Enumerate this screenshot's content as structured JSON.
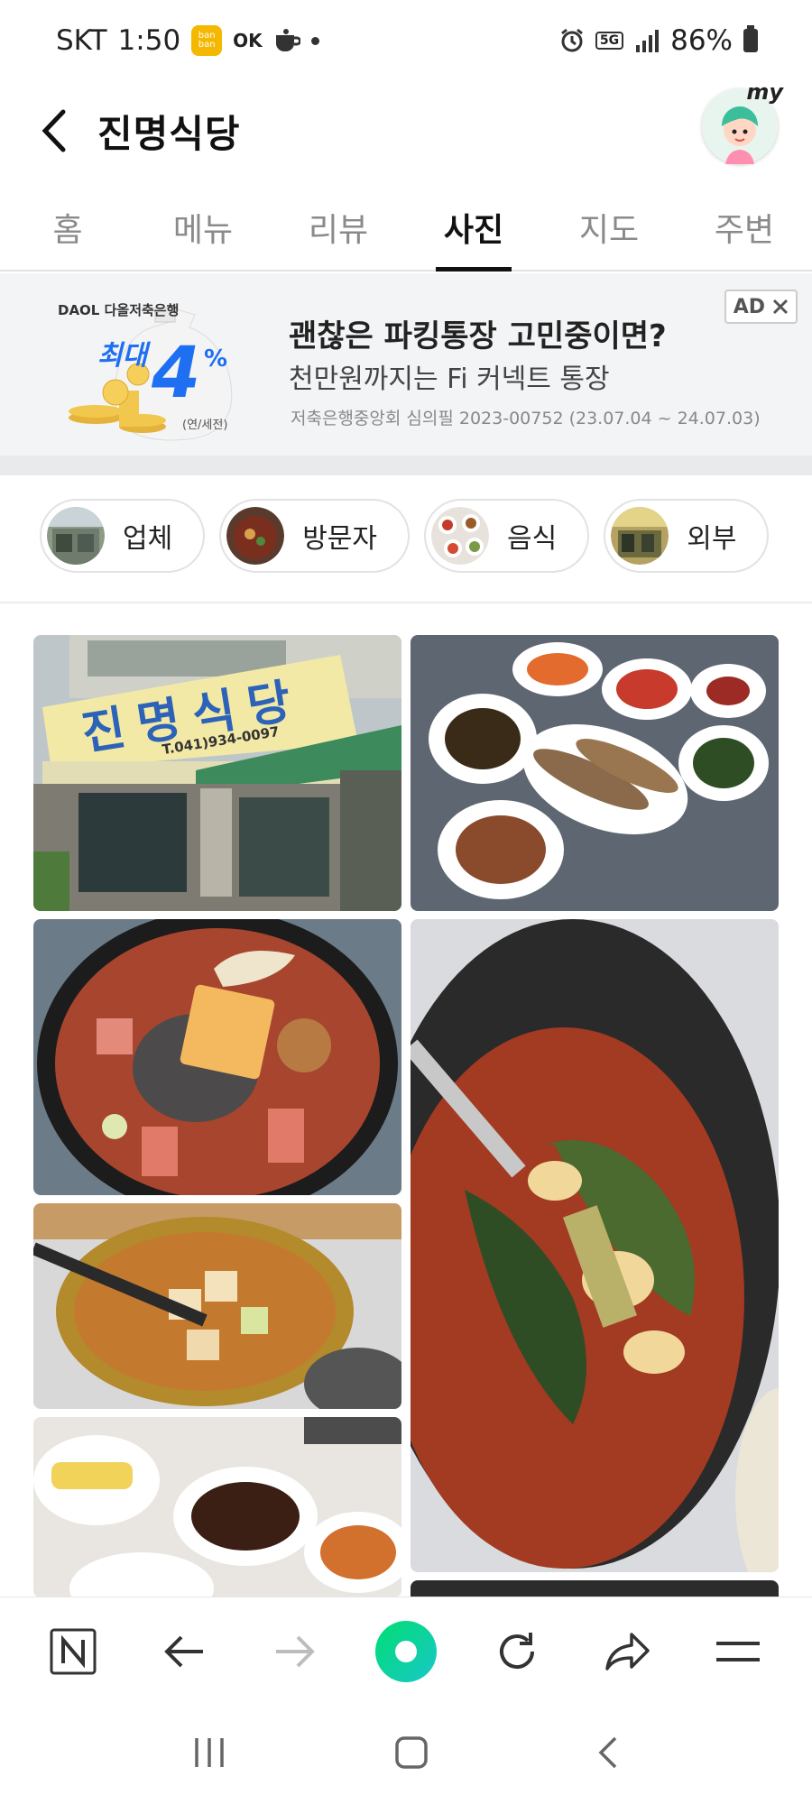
{
  "status": {
    "carrier": "SKT",
    "time": "1:50",
    "app_badge": "ban ban",
    "ok": "OK",
    "network": "5G",
    "battery": "86%"
  },
  "header": {
    "title": "진명식당",
    "my": "my"
  },
  "tabs": [
    "홈",
    "메뉴",
    "리뷰",
    "사진",
    "지도",
    "주변"
  ],
  "active_tab": "사진",
  "ad": {
    "brand": "DAOL 다올저축은행",
    "promo_top": "최대",
    "promo_rate": "4",
    "promo_pct": "%",
    "promo_note": "(연/세전)",
    "title": "괜찮은 파킹통장 고민중이면?",
    "subtitle": "천만원까지는 Fi 커넥트 통장",
    "fine": "저축은행중앙회 심의필 2023-00752 (23.07.04 ~ 24.07.03)",
    "badge": "AD"
  },
  "chips": [
    "업체",
    "방문자",
    "음식",
    "외부"
  ],
  "storefront": {
    "sign": "진명식당",
    "phone": "T.041)934-0097"
  },
  "colors": {
    "accent_green": "#03c75a",
    "active_text": "#111111",
    "muted_text": "#8a8a8a"
  }
}
